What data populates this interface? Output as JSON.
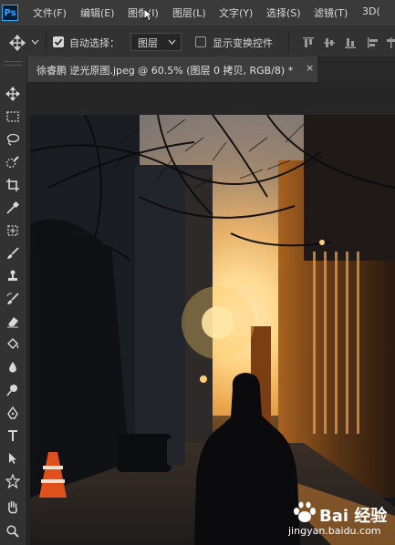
{
  "menu": {
    "logo": "Ps",
    "items": [
      "文件(F)",
      "编辑(E)",
      "图像(I)",
      "图层(L)",
      "文字(Y)",
      "选择(S)",
      "滤镜(T)",
      "3D("
    ]
  },
  "options_bar": {
    "auto_select_label": "自动选择：",
    "auto_select_checked": true,
    "layer_select_value": "图层",
    "show_transform_label": "显示变换控件",
    "show_transform_checked": false
  },
  "document": {
    "tab_title": "徐睿鹏 逆光原图.jpeg @ 60.5% (图层 0 拷贝, RGB/8) *",
    "close_glyph": "×"
  },
  "watermark": {
    "brand": "Bai 经验",
    "url": "jingyan.baidu.com"
  },
  "colors": {
    "menubar": "#3a3a3a",
    "panel": "#323232",
    "workspace": "#282828",
    "accent": "#31a8ff"
  }
}
